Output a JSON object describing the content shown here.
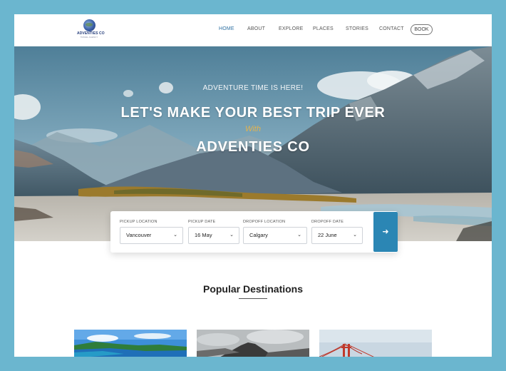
{
  "brand": {
    "logo_text": "ADVENTIES CO",
    "logo_tagline": "TRAVEL AGENCY"
  },
  "nav": {
    "items": [
      {
        "label": "HOME",
        "active": true
      },
      {
        "label": "ABOUT"
      },
      {
        "label": "EXPLORE"
      },
      {
        "label": "PLACES"
      },
      {
        "label": "STORIES"
      },
      {
        "label": "CONTACT"
      }
    ],
    "book_label": "BOOK",
    "active_color": "#2d6fa1"
  },
  "hero": {
    "eyebrow": "ADVENTURE TIME IS HERE!",
    "title": "LET'S MAKE YOUR BEST TRIP EVER",
    "with": "With",
    "brand": "ADVENTIES CO"
  },
  "booking": {
    "fields": [
      {
        "label": "PICKUP LOCATION",
        "value": "Vancouver"
      },
      {
        "label": "PICKUP DATE",
        "value": "16 May"
      },
      {
        "label": "DROPOFF LOCATION",
        "value": "Calgary"
      },
      {
        "label": "DROPOFF DATE",
        "value": "22 June"
      }
    ],
    "submit_icon": "arrow-right-icon",
    "accent": "#2b86b4"
  },
  "popular": {
    "title": "Popular Destinations",
    "cards": [
      {
        "image": "tropical-coast"
      },
      {
        "image": "volcano"
      },
      {
        "image": "golden-gate-bridge"
      }
    ]
  },
  "colors": {
    "page_background": "#6bb6cf",
    "accent": "#2b86b4",
    "with_gold": "#e5b34d"
  }
}
